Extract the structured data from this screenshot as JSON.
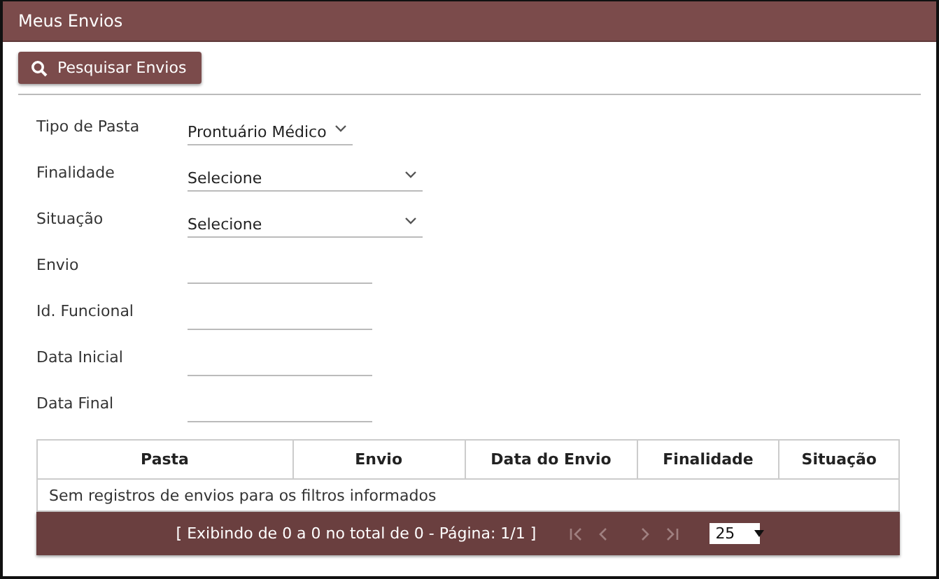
{
  "header": {
    "title": "Meus Envios"
  },
  "search_button": {
    "label": "Pesquisar Envios"
  },
  "filters": [
    {
      "label": "Tipo de Pasta",
      "kind": "select",
      "value": "Prontuário Médico"
    },
    {
      "label": "Finalidade",
      "kind": "select",
      "value": "Selecione"
    },
    {
      "label": "Situação",
      "kind": "select",
      "value": "Selecione"
    },
    {
      "label": "Envio",
      "kind": "text"
    },
    {
      "label": "Id. Funcional",
      "kind": "text"
    },
    {
      "label": "Data Inicial",
      "kind": "text"
    },
    {
      "label": "Data Final",
      "kind": "text"
    }
  ],
  "table": {
    "columns": [
      "Pasta",
      "Envio",
      "Data do Envio",
      "Finalidade",
      "Situação"
    ],
    "empty_message": "Sem registros de envios para os filtros informados",
    "pager": {
      "summary": "[ Exibindo de 0 a 0 no total de 0 - Página: 1/1 ]",
      "first_disabled": true,
      "prev_disabled": true,
      "next_disabled": true,
      "last_disabled": true,
      "page_size": "25"
    }
  }
}
